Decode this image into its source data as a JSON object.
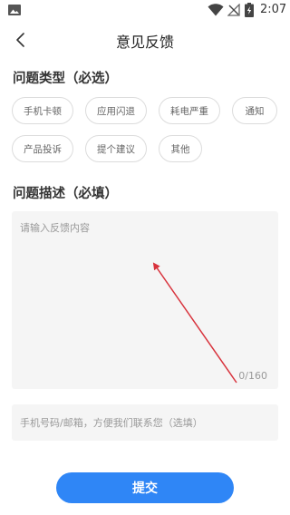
{
  "status_bar": {
    "time": "2:07",
    "icons": [
      "gallery-icon",
      "wifi-icon",
      "no-signal-icon",
      "battery-charging-icon"
    ]
  },
  "header": {
    "title": "意见反馈",
    "back_icon": "chevron-left-icon"
  },
  "problem_type": {
    "title": "问题类型（必选）",
    "options": [
      "手机卡顿",
      "应用闪退",
      "耗电严重",
      "通知",
      "产品投诉",
      "提个建议",
      "其他"
    ]
  },
  "description": {
    "title": "问题描述（必填）",
    "placeholder": "请输入反馈内容",
    "value": "",
    "counter": "0/160"
  },
  "contact": {
    "placeholder": "手机号码/邮箱，方便我们联系您（选填）",
    "value": ""
  },
  "submit_label": "提交",
  "colors": {
    "accent": "#2f86f6",
    "annotation_arrow": "#d8323c",
    "input_bg": "#f5f5f5",
    "chip_border": "#dcdcdc"
  }
}
